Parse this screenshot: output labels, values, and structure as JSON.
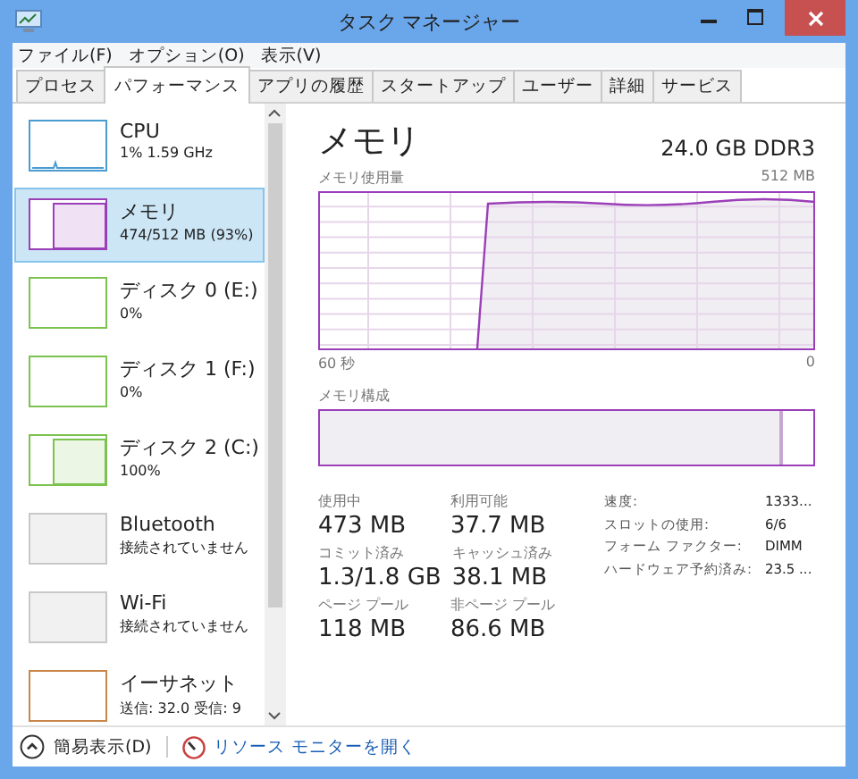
{
  "window": {
    "title": "タスク マネージャー"
  },
  "menu": [
    "ファイル(F)",
    "オプション(O)",
    "表示(V)"
  ],
  "tabs": [
    {
      "label": "プロセス",
      "selected": false
    },
    {
      "label": "パフォーマンス",
      "selected": true
    },
    {
      "label": "アプリの履歴",
      "selected": false
    },
    {
      "label": "スタートアップ",
      "selected": false
    },
    {
      "label": "ユーザー",
      "selected": false
    },
    {
      "label": "詳細",
      "selected": false
    },
    {
      "label": "サービス",
      "selected": false
    }
  ],
  "sidebar": {
    "items": [
      {
        "name": "CPU",
        "detail": "1% 1.59 GHz",
        "kind": "blip",
        "color": "#4a9bd1",
        "selected": false
      },
      {
        "name": "メモリ",
        "detail": "474/512 MB (93%)",
        "kind": "step",
        "color": "#9b3fb8",
        "selected": true
      },
      {
        "name": "ディスク 0 (E:)",
        "detail": "0%",
        "kind": "empty",
        "color": "#7cc24e",
        "selected": false
      },
      {
        "name": "ディスク 1 (F:)",
        "detail": "0%",
        "kind": "empty",
        "color": "#7cc24e",
        "selected": false
      },
      {
        "name": "ディスク 2 (C:)",
        "detail": "100%",
        "kind": "step",
        "color": "#7cc24e",
        "selected": false
      },
      {
        "name": "Bluetooth",
        "detail": "接続されていません",
        "kind": "off",
        "color": "#c8c8c8",
        "selected": false
      },
      {
        "name": "Wi-Fi",
        "detail": "接続されていません",
        "kind": "off",
        "color": "#c8c8c8",
        "selected": false
      },
      {
        "name": "イーサネット",
        "detail": "送信: 32.0 受信: 9",
        "kind": "empty",
        "color": "#c8864a",
        "selected": false
      }
    ]
  },
  "panel": {
    "title": "メモリ",
    "spec": "24.0 GB DDR3",
    "usage_label": "メモリ使用量",
    "usage_max": "512 MB",
    "time_start": "60 秒",
    "time_end": "0",
    "composition_label": "メモリ構成",
    "stats": [
      {
        "label": "使用中",
        "value": "473 MB"
      },
      {
        "label": "利用可能",
        "value": "37.7 MB"
      },
      {
        "label": "コミット済み",
        "value": "1.3/1.8 GB"
      },
      {
        "label": "キャッシュ済み",
        "value": "38.1 MB"
      },
      {
        "label": "ページ プール",
        "value": "118 MB"
      },
      {
        "label": "非ページ プール",
        "value": "86.6 MB"
      }
    ],
    "properties": [
      {
        "label": "速度:",
        "value": "1333..."
      },
      {
        "label": "スロットの使用:",
        "value": "6/6"
      },
      {
        "label": "フォーム ファクター:",
        "value": "DIMM"
      },
      {
        "label": "ハードウェア予約済み:",
        "value": "23.5 ..."
      }
    ]
  },
  "footer": {
    "fewer_details": "簡易表示(D)",
    "resource_monitor": "リソース モニターを開く"
  }
}
